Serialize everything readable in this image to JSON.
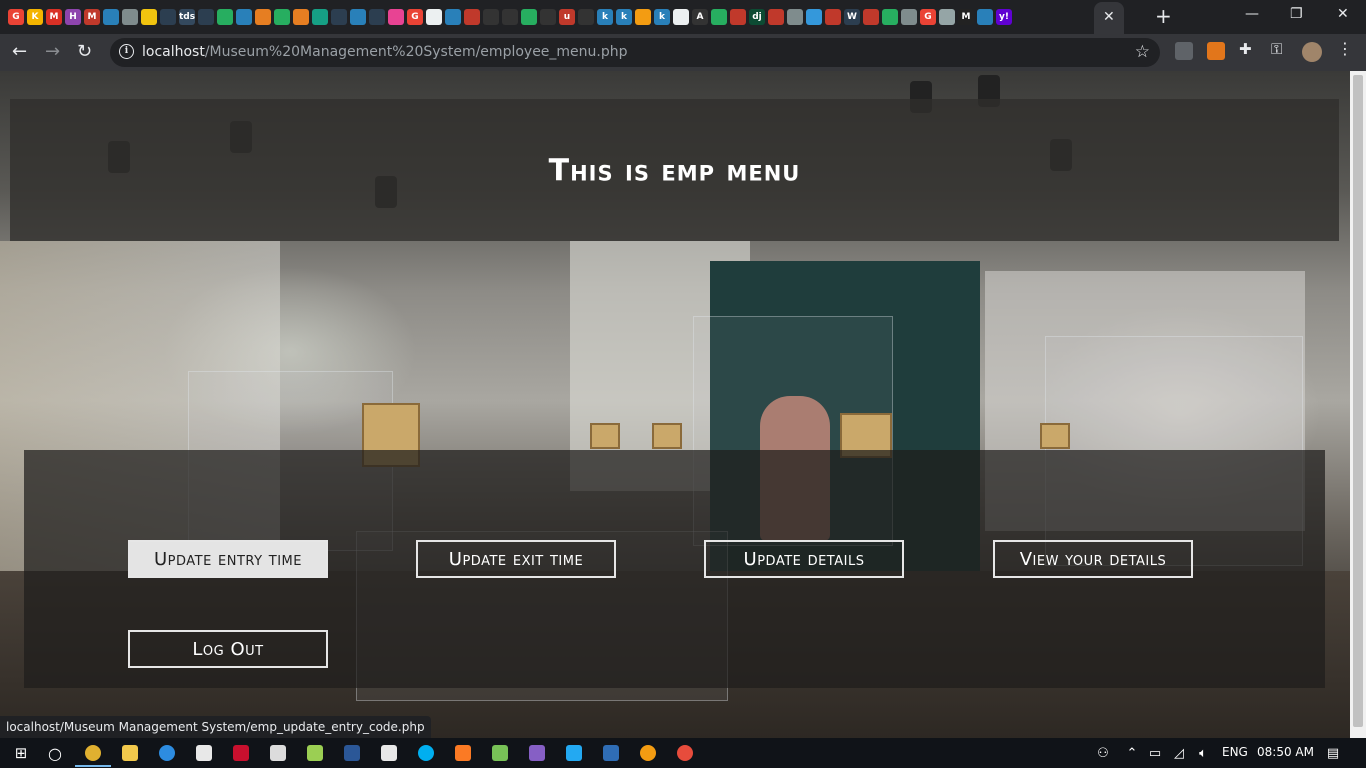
{
  "browser": {
    "active_tab_close": "✕",
    "new_tab": "+",
    "window_controls": {
      "minimize": "—",
      "maximize": "❐",
      "close": "✕"
    },
    "url_host": "localhost",
    "url_path": "/Museum%20Management%20System/employee_menu.php",
    "favicons": [
      {
        "letter": "G",
        "color": "#ea4335"
      },
      {
        "letter": "K",
        "color": "#f4b400"
      },
      {
        "letter": "M",
        "color": "#d93025"
      },
      {
        "letter": "H",
        "color": "#8e44ad"
      },
      {
        "letter": "M",
        "color": "#c0392b"
      },
      {
        "letter": "",
        "color": "#2980b9"
      },
      {
        "letter": "",
        "color": "#7f8c8d"
      },
      {
        "letter": "",
        "color": "#f1c40f"
      },
      {
        "letter": "",
        "color": "#2c3e50"
      },
      {
        "letter": "tds",
        "color": "#34495e"
      },
      {
        "letter": "",
        "color": "#2c3e50"
      },
      {
        "letter": "",
        "color": "#27ae60"
      },
      {
        "letter": "",
        "color": "#2980b9"
      },
      {
        "letter": "",
        "color": "#e67e22"
      },
      {
        "letter": "",
        "color": "#27ae60"
      },
      {
        "letter": "",
        "color": "#e67e22"
      },
      {
        "letter": "",
        "color": "#16a085"
      },
      {
        "letter": "",
        "color": "#2c3e50"
      },
      {
        "letter": "",
        "color": "#2980b9"
      },
      {
        "letter": "",
        "color": "#2c3e50"
      },
      {
        "letter": "",
        "color": "#e84393"
      },
      {
        "letter": "G",
        "color": "#ea4335"
      },
      {
        "letter": "",
        "color": "#ecf0f1"
      },
      {
        "letter": "",
        "color": "#2980b9"
      },
      {
        "letter": "",
        "color": "#c0392b"
      },
      {
        "letter": "",
        "color": "#333"
      },
      {
        "letter": "",
        "color": "#333"
      },
      {
        "letter": "",
        "color": "#27ae60"
      },
      {
        "letter": "",
        "color": "#333"
      },
      {
        "letter": "u",
        "color": "#c0392b"
      },
      {
        "letter": "",
        "color": "#333"
      },
      {
        "letter": "k",
        "color": "#2980b9"
      },
      {
        "letter": "k",
        "color": "#2980b9"
      },
      {
        "letter": "",
        "color": "#f39c12"
      },
      {
        "letter": "k",
        "color": "#2980b9"
      },
      {
        "letter": "",
        "color": "#ecf0f1"
      },
      {
        "letter": "A",
        "color": "#333"
      },
      {
        "letter": "",
        "color": "#27ae60"
      },
      {
        "letter": "",
        "color": "#c0392b"
      },
      {
        "letter": "dj",
        "color": "#0c4b33"
      },
      {
        "letter": "",
        "color": "#c0392b"
      },
      {
        "letter": "",
        "color": "#7f8c8d"
      },
      {
        "letter": "",
        "color": "#3498db"
      },
      {
        "letter": "",
        "color": "#c0392b"
      },
      {
        "letter": "W",
        "color": "#2c3e50"
      },
      {
        "letter": "",
        "color": "#c0392b"
      },
      {
        "letter": "",
        "color": "#27ae60"
      },
      {
        "letter": "",
        "color": "#7f8c8d"
      },
      {
        "letter": "G",
        "color": "#ea4335"
      },
      {
        "letter": "",
        "color": "#95a5a6"
      },
      {
        "letter": "M",
        "color": "#222"
      },
      {
        "letter": "",
        "color": "#2980b9"
      },
      {
        "letter": "y!",
        "color": "#6001d2"
      }
    ]
  },
  "page": {
    "title": "This is emp menu",
    "buttons": {
      "update_entry": "Update entry time",
      "update_exit": "Update exit time",
      "update_details": "Update details",
      "view_details": "View your details",
      "logout": "Log Out"
    },
    "status_url": "localhost/Museum Management System/emp_update_entry_code.php"
  },
  "taskbar": {
    "language": "ENG",
    "time": "08:50 AM"
  }
}
